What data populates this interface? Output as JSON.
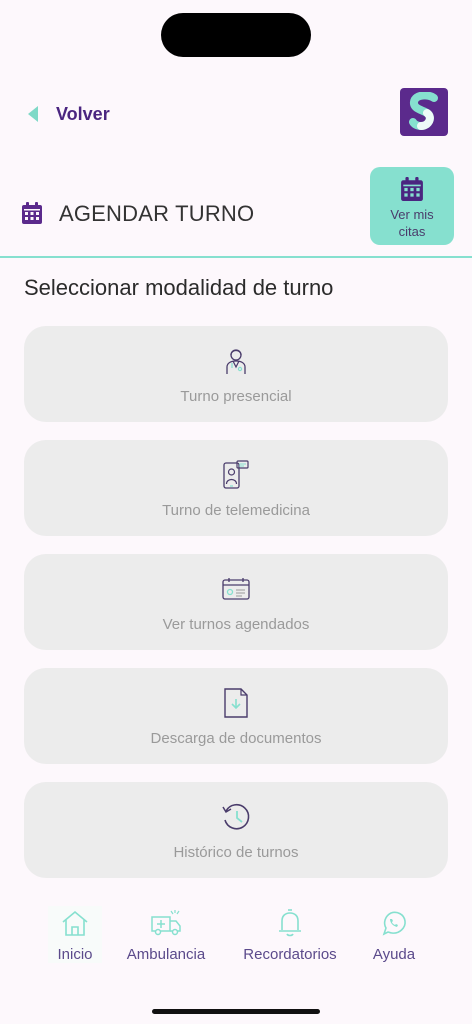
{
  "header": {
    "back_label": "Volver"
  },
  "title": {
    "page_title": "AGENDAR TURNO",
    "ver_citas_label": "Ver mis citas"
  },
  "section": {
    "title": "Seleccionar modalidad de turno"
  },
  "options": [
    {
      "label": "Turno presencial",
      "icon": "doctor-icon"
    },
    {
      "label": "Turno de telemedicina",
      "icon": "telemedicine-icon"
    },
    {
      "label": "Ver turnos agendados",
      "icon": "calendar-card-icon"
    },
    {
      "label": "Descarga de documentos",
      "icon": "document-download-icon"
    },
    {
      "label": "Histórico de turnos",
      "icon": "history-clock-icon"
    }
  ],
  "tabbar": [
    {
      "label": "Inicio",
      "icon": "home-icon",
      "active": true
    },
    {
      "label": "Ambulancia",
      "icon": "ambulance-icon"
    },
    {
      "label": "Recordatorios",
      "icon": "bell-icon"
    },
    {
      "label": "Ayuda",
      "icon": "whatsapp-icon"
    }
  ],
  "colors": {
    "accent": "#86e0cf",
    "brand": "#5b2a8c",
    "text_purple": "#4a2580",
    "option_bg": "#ececec",
    "option_text": "#9a9a9a"
  }
}
